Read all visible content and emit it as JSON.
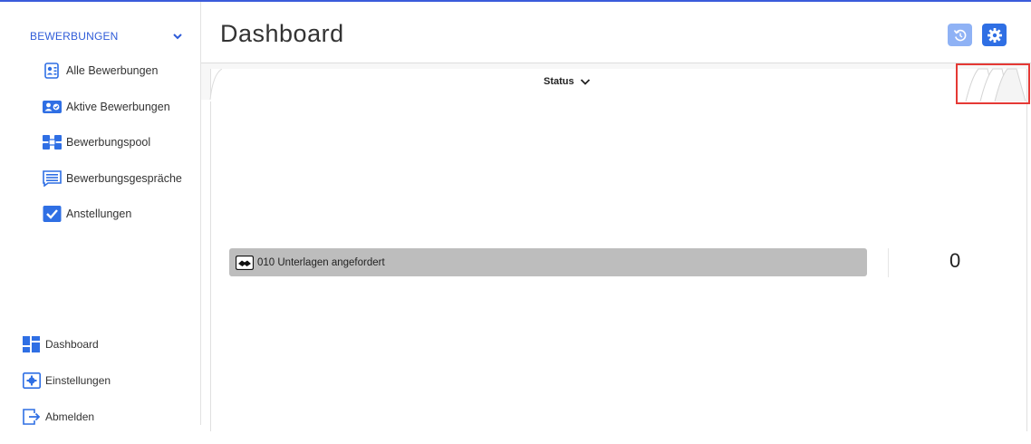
{
  "sidebar": {
    "section": {
      "label": "BEWERBUNGEN",
      "icon": "chevron-down-icon"
    },
    "items": [
      {
        "label": "Alle Bewerbungen",
        "icon": "contact-card-icon"
      },
      {
        "label": "Aktive Bewerbungen",
        "icon": "active-user-icon"
      },
      {
        "label": "Bewerbungspool",
        "icon": "pool-icon"
      },
      {
        "label": "Bewerbungsgespräche",
        "icon": "chat-list-icon"
      },
      {
        "label": "Anstellungen",
        "icon": "check-icon"
      }
    ],
    "bottom": [
      {
        "label": "Dashboard",
        "icon": "dashboard-icon"
      },
      {
        "label": "Einstellungen",
        "icon": "gear-icon"
      },
      {
        "label": "Abmelden",
        "icon": "logout-icon"
      }
    ]
  },
  "header": {
    "title": "Dashboard",
    "buttons": {
      "reset_icon": "reset-icon",
      "settings_icon": "gear-icon"
    }
  },
  "dashboard": {
    "tab_label": "Status",
    "rows": [
      {
        "label": "010 Unterlagen angefordert",
        "icon": "handshake-icon",
        "count": "0"
      }
    ]
  },
  "colors": {
    "accent": "#2f6fe4",
    "accent_light": "#8fb2f5",
    "highlight": "#e53935",
    "bar": "#bdbdbd"
  }
}
